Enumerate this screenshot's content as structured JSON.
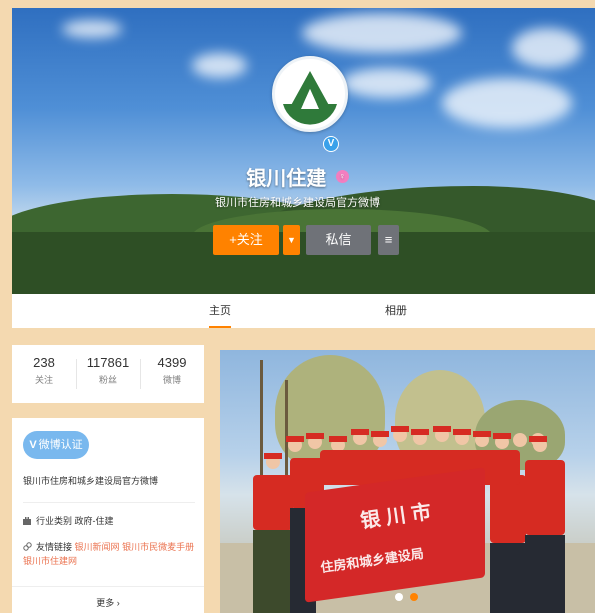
{
  "profile": {
    "name": "银川住建",
    "description": "银川市住房和城乡建设局官方微博",
    "verified_badge": "V",
    "gender_icon": "♀"
  },
  "actions": {
    "follow_label": "+关注",
    "dropdown_glyph": "▼",
    "message_label": "私信",
    "more_glyph": "≡"
  },
  "tabs": [
    {
      "label": "主页",
      "active": true
    },
    {
      "label": "相册",
      "active": false
    }
  ],
  "stats": [
    {
      "value": "238",
      "label": "关注"
    },
    {
      "value": "117861",
      "label": "粉丝"
    },
    {
      "value": "4399",
      "label": "微博"
    }
  ],
  "info": {
    "cert_badge": "微博认证",
    "cert_badge_v": "V",
    "cert_text": "银川市住房和城乡建设局官方微博",
    "industry_label": "行业类别",
    "industry_value": "政府-住建",
    "links_label": "友情链接",
    "links": [
      "银川新闻网",
      "银川市民微麦手册",
      "银川市住建网"
    ],
    "more_label": "更多",
    "more_glyph": "›"
  },
  "photo": {
    "banner_line1": "银 川 市",
    "banner_line2": "住房和城乡建设局"
  },
  "colors": {
    "accent": "#ff8200",
    "link": "#eb7350",
    "cert_blue": "#79b8ee",
    "dark_button": "#6f7278"
  }
}
